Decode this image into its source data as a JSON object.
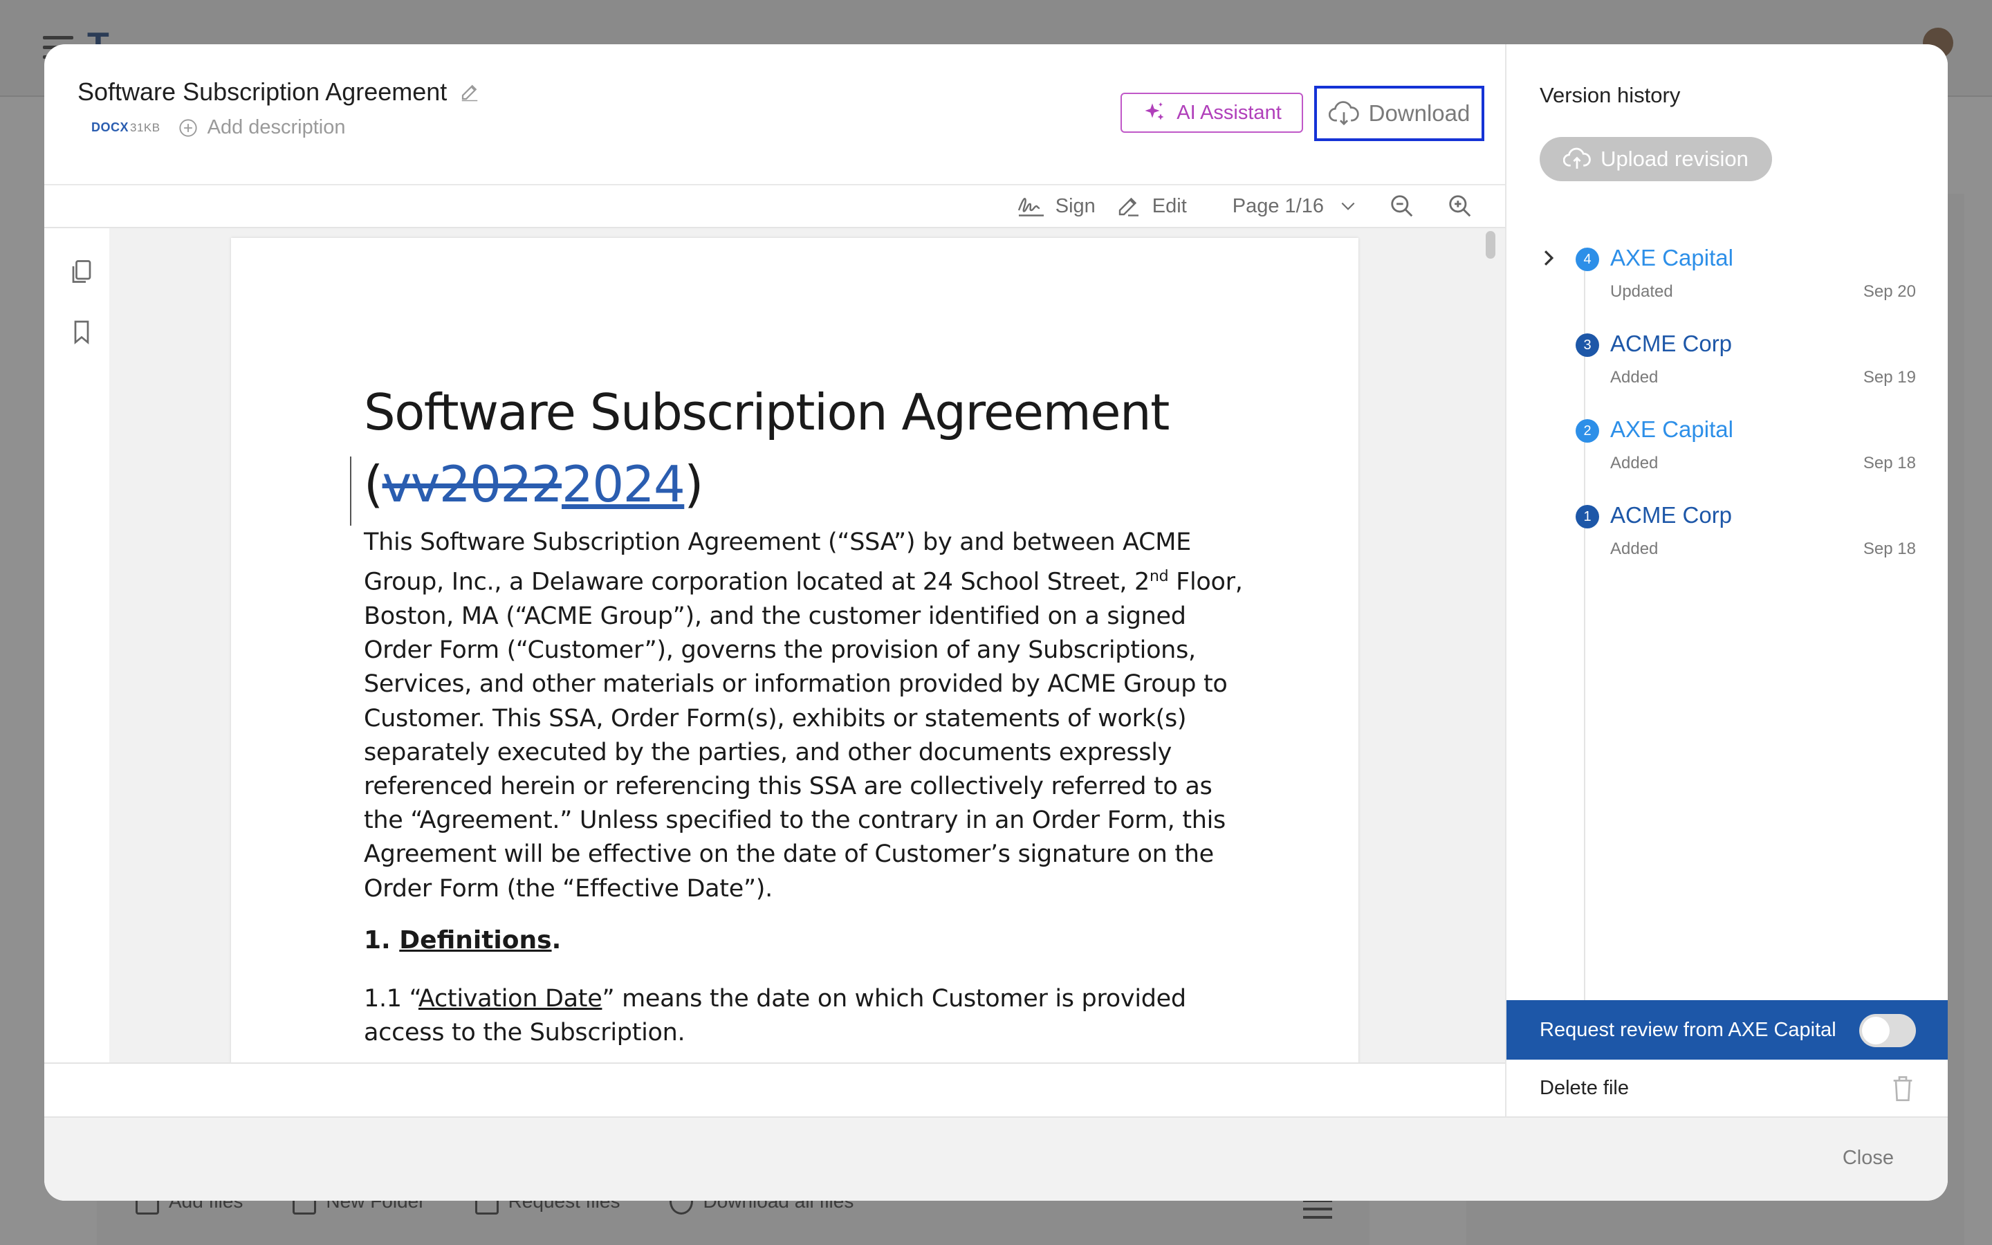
{
  "background": {
    "bottom_actions": [
      "Add files",
      "New Folder",
      "Request files",
      "Download all files"
    ]
  },
  "header": {
    "title": "Software Subscription Agreement",
    "file_type": "DOCX",
    "file_size": "31KB",
    "add_description": "Add description",
    "ai_assistant_label": "AI Assistant",
    "download_label": "Download"
  },
  "toolbar": {
    "sign_label": "Sign",
    "edit_label": "Edit",
    "page_indicator": "Page 1/16"
  },
  "document": {
    "title_main": "Software Subscription Agreement",
    "title_open": "(",
    "title_deleted": "vv2022",
    "title_inserted": "2024",
    "title_close": ")",
    "intro_part1": "This Software Subscription Agreement (“SSA”) by and between ACME Group, Inc., a Delaware corporation located at 24 School Street, 2",
    "intro_sup": "nd",
    "intro_part2": " Floor, Boston, MA (“ACME Group”), and the customer identified on a signed Order Form (“Customer”), governs the provision of any Subscriptions, Services, and other materials or information provided by ACME Group to Customer. This SSA, Order Form(s), exhibits or statements of work(s) separately executed by the parties, and other documents expressly referenced herein or referencing this SSA are collectively referred to as the “Agreement.”  Unless specified to the contrary in an Order Form, this Agreement will be effective on the date of Customer’s signature on the Order Form (the “Effective Date”).",
    "section_number": "1. ",
    "section_title": "Definitions",
    "section_period": ".",
    "clause_prefix": "1.1 “",
    "clause_term": "Activation Date",
    "clause_rest": "” means the date on which Customer is provided access to the Subscription."
  },
  "sidebar": {
    "title": "Version history",
    "upload_label": "Upload revision",
    "versions": [
      {
        "number": "4",
        "name": "AXE Capital",
        "status": "Updated",
        "date": "Sep 20",
        "color": "#2d8fe8"
      },
      {
        "number": "3",
        "name": "ACME Corp",
        "status": "Added",
        "date": "Sep 19",
        "color": "#1d57a8"
      },
      {
        "number": "2",
        "name": "AXE Capital",
        "status": "Added",
        "date": "Sep 18",
        "color": "#2d8fe8"
      },
      {
        "number": "1",
        "name": "ACME Corp",
        "status": "Added",
        "date": "Sep 18",
        "color": "#1d57a8"
      }
    ],
    "review_label": "Request review from AXE Capital",
    "review_enabled": false,
    "delete_label": "Delete file"
  },
  "footer": {
    "close_label": "Close"
  },
  "colors": {
    "accent_blue": "#1d57a8",
    "link_blue": "#2d8fe8",
    "ai_purple": "#b03fba",
    "download_outline": "#1533d6"
  }
}
